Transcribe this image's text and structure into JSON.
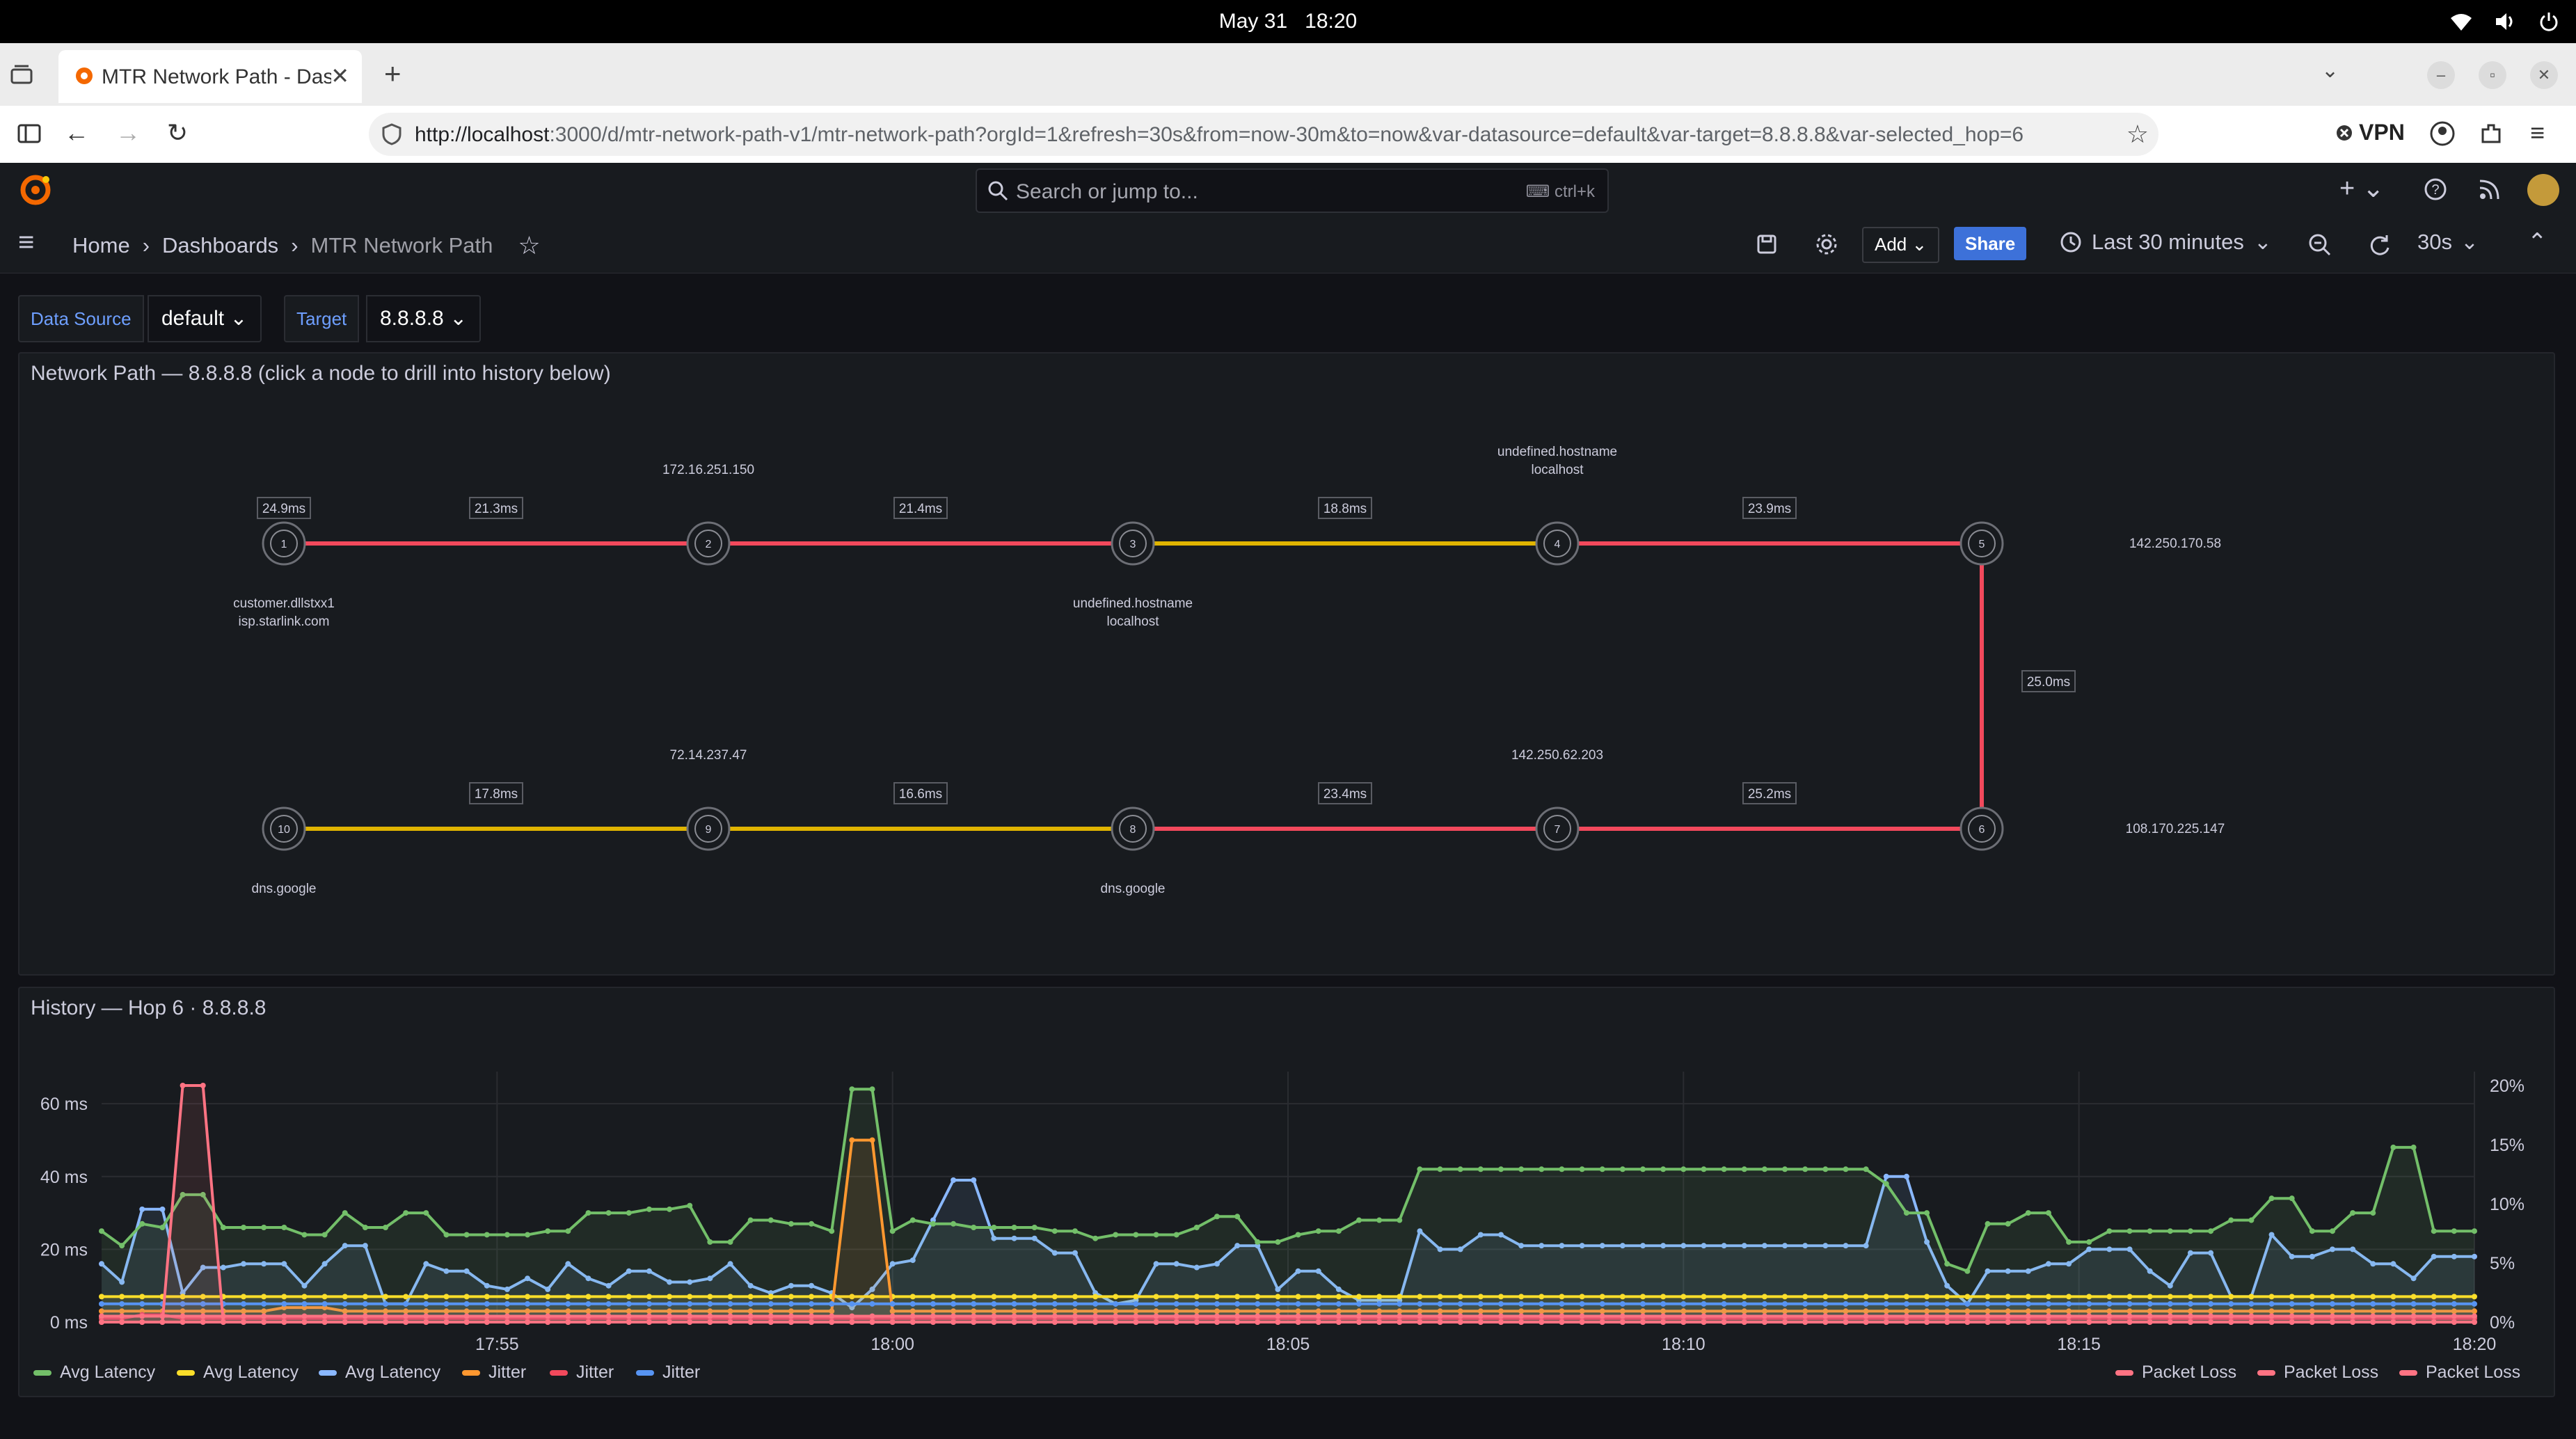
{
  "os": {
    "date": "May 31",
    "time": "18:20"
  },
  "browser": {
    "tab_title": "MTR Network Path - Dashboards",
    "url_host": "http://localhost",
    "url_rest": ":3000/d/mtr-network-path-v1/mtr-network-path?orgId=1&refresh=30s&from=now-30m&to=now&var-datasource=default&var-target=8.8.8.8&var-selected_hop=6",
    "vpn_label": "VPN"
  },
  "grafana": {
    "search_placeholder": "Search or jump to...",
    "search_shortcut": "ctrl+k",
    "breadcrumb": [
      "Home",
      "Dashboards",
      "MTR Network Path"
    ],
    "add_label": "Add",
    "share_label": "Share",
    "time_range": "Last 30 minutes",
    "refresh_interval": "30s"
  },
  "variables": {
    "datasource_label": "Data Source",
    "datasource_value": "default",
    "target_label": "Target",
    "target_value": "8.8.8.8"
  },
  "network_panel": {
    "title": "Network Path — 8.8.8.8 (click a node to drill into history below)",
    "nodes": [
      {
        "id": "1",
        "labels": [
          "customer.dllstxx1",
          "isp.starlink.com"
        ]
      },
      {
        "id": "2",
        "labels": [
          "172.16.251.150"
        ]
      },
      {
        "id": "3",
        "labels": [
          "undefined.hostname",
          "localhost"
        ]
      },
      {
        "id": "4",
        "labels": [
          "undefined.hostname",
          "localhost"
        ]
      },
      {
        "id": "5",
        "labels": [
          "142.250.170.58"
        ]
      },
      {
        "id": "6",
        "labels": [
          "108.170.225.147"
        ]
      },
      {
        "id": "7",
        "labels": [
          "142.250.62.203"
        ]
      },
      {
        "id": "8",
        "labels": [
          "dns.google"
        ]
      },
      {
        "id": "9",
        "labels": [
          "72.14.237.47"
        ]
      },
      {
        "id": "10",
        "labels": [
          "dns.google"
        ]
      }
    ],
    "node1_latency": "24.9ms",
    "edges": [
      {
        "from": "1",
        "to": "2",
        "latency": "21.3ms",
        "status": "red"
      },
      {
        "from": "2",
        "to": "3",
        "latency": "21.4ms",
        "status": "red"
      },
      {
        "from": "3",
        "to": "4",
        "latency": "18.8ms",
        "status": "yellow"
      },
      {
        "from": "4",
        "to": "5",
        "latency": "23.9ms",
        "status": "red"
      },
      {
        "from": "5",
        "to": "6",
        "latency": "25.0ms",
        "status": "red"
      },
      {
        "from": "6",
        "to": "7",
        "latency": "25.2ms",
        "status": "red"
      },
      {
        "from": "7",
        "to": "8",
        "latency": "23.4ms",
        "status": "red"
      },
      {
        "from": "8",
        "to": "9",
        "latency": "16.6ms",
        "status": "yellow"
      },
      {
        "from": "9",
        "to": "10",
        "latency": "17.8ms",
        "status": "yellow"
      }
    ],
    "colors": {
      "red": "#f2495c",
      "yellow": "#e0b400"
    }
  },
  "history_panel": {
    "title": "History — Hop 6 · 8.8.8.8",
    "legend_left": [
      {
        "label": "Avg Latency",
        "color": "#73bf69"
      },
      {
        "label": "Avg Latency",
        "color": "#fade2a"
      },
      {
        "label": "Avg Latency",
        "color": "#8ab8ff"
      },
      {
        "label": "Jitter",
        "color": "#ff9830"
      },
      {
        "label": "Jitter",
        "color": "#f2495c"
      },
      {
        "label": "Jitter",
        "color": "#5794f2"
      }
    ],
    "legend_right": [
      {
        "label": "Packet Loss",
        "color": "#ff7383"
      },
      {
        "label": "Packet Loss",
        "color": "#ff7383"
      },
      {
        "label": "Packet Loss",
        "color": "#ff7383"
      }
    ]
  },
  "chart_data": {
    "type": "line",
    "title": "History — Hop 6 · 8.8.8.8",
    "x_ticks": [
      "17:55",
      "18:00",
      "18:05",
      "18:10",
      "18:15",
      "18:20"
    ],
    "y_left_ticks": [
      "0 ms",
      "20 ms",
      "40 ms",
      "60 ms"
    ],
    "y_right_ticks": [
      "0%",
      "5%",
      "10%",
      "15%",
      "20%"
    ],
    "ylim_left": [
      0,
      65
    ],
    "ylim_right": [
      0,
      20
    ],
    "x_range_minutes": [
      0,
      30
    ],
    "series": [
      {
        "name": "Avg Latency",
        "color": "#73bf69",
        "axis": "left",
        "values": [
          25,
          21,
          27,
          26,
          35,
          35,
          26,
          26,
          26,
          26,
          24,
          24,
          30,
          26,
          26,
          30,
          30,
          24,
          24,
          24,
          24,
          24,
          25,
          25,
          30,
          30,
          30,
          31,
          31,
          32,
          22,
          22,
          28,
          28,
          27,
          27,
          25,
          64,
          64,
          25,
          28,
          27,
          27,
          26,
          26,
          26,
          26,
          25,
          25,
          23,
          24,
          24,
          24,
          24,
          26,
          29,
          29,
          22,
          22,
          24,
          25,
          25,
          28,
          28,
          28,
          42,
          42,
          42,
          42,
          42,
          42,
          42,
          42,
          42,
          42,
          42,
          42,
          42,
          42,
          42,
          42,
          42,
          42,
          42,
          42,
          42,
          42,
          42,
          38,
          30,
          30,
          16,
          14,
          27,
          27,
          30,
          30,
          22,
          22,
          25,
          25,
          25,
          25,
          25,
          25,
          28,
          28,
          34,
          34,
          25,
          25,
          30,
          30,
          48,
          48,
          25,
          25,
          25
        ]
      },
      {
        "name": "Avg Latency",
        "color": "#fade2a",
        "axis": "left",
        "values": [
          7,
          7,
          7,
          7,
          7,
          7,
          7,
          7,
          7,
          7,
          7,
          7,
          7,
          7,
          7,
          7,
          7,
          7,
          7,
          7,
          7,
          7,
          7,
          7,
          7,
          7,
          7,
          7,
          7,
          7,
          7,
          7,
          7,
          7,
          7,
          7,
          7,
          7,
          7,
          7,
          7,
          7,
          7,
          7,
          7,
          7,
          7,
          7,
          7,
          7,
          7,
          7,
          7,
          7,
          7,
          7,
          7,
          7,
          7,
          7,
          7,
          7,
          7,
          7,
          7,
          7,
          7,
          7,
          7,
          7,
          7,
          7,
          7,
          7,
          7,
          7,
          7,
          7,
          7,
          7,
          7,
          7,
          7,
          7,
          7,
          7,
          7,
          7,
          7,
          7,
          7,
          7,
          7,
          7,
          7,
          7,
          7,
          7,
          7,
          7,
          7,
          7,
          7,
          7,
          7,
          7,
          7,
          7,
          7,
          7,
          7,
          7,
          7,
          7,
          7,
          7,
          7,
          7
        ]
      },
      {
        "name": "Avg Latency",
        "color": "#8ab8ff",
        "axis": "left",
        "values": [
          16,
          11,
          31,
          31,
          8,
          15,
          15,
          16,
          16,
          16,
          10,
          16,
          21,
          21,
          5,
          5,
          16,
          14,
          14,
          10,
          9,
          12,
          9,
          16,
          12,
          10,
          14,
          14,
          11,
          11,
          12,
          16,
          10,
          8,
          10,
          10,
          8,
          4,
          9,
          16,
          17,
          28,
          39,
          39,
          23,
          23,
          23,
          19,
          19,
          8,
          5,
          6,
          16,
          16,
          15,
          16,
          21,
          21,
          9,
          14,
          14,
          9,
          6,
          6,
          6,
          25,
          20,
          20,
          24,
          24,
          21,
          21,
          21,
          21,
          21,
          21,
          21,
          21,
          21,
          21,
          21,
          21,
          21,
          21,
          21,
          21,
          21,
          21,
          40,
          40,
          22,
          10,
          5,
          14,
          14,
          14,
          16,
          16,
          20,
          20,
          20,
          14,
          10,
          19,
          19,
          7,
          7,
          24,
          18,
          18,
          20,
          20,
          16,
          16,
          12,
          18,
          18,
          18
        ]
      },
      {
        "name": "Jitter",
        "color": "#ff9830",
        "axis": "left",
        "values": [
          3,
          3,
          3,
          3,
          3,
          3,
          3,
          3,
          3,
          4,
          4,
          4,
          3,
          3,
          3,
          3,
          3,
          3,
          3,
          3,
          3,
          3,
          3,
          3,
          3,
          3,
          3,
          3,
          3,
          3,
          3,
          3,
          3,
          3,
          3,
          3,
          3,
          50,
          50,
          3,
          3,
          3,
          3,
          3,
          3,
          3,
          3,
          3,
          3,
          3,
          3,
          3,
          3,
          3,
          3,
          3,
          3,
          3,
          3,
          3,
          3,
          3,
          3,
          3,
          3,
          3,
          3,
          3,
          3,
          3,
          3,
          3,
          3,
          3,
          3,
          3,
          3,
          3,
          3,
          3,
          3,
          3,
          3,
          3,
          3,
          3,
          3,
          3,
          3,
          3,
          3,
          3,
          3,
          3,
          3,
          3,
          3,
          3,
          3,
          3,
          3,
          3,
          3,
          3,
          3,
          3,
          3,
          3,
          3,
          3,
          3,
          3,
          3,
          3,
          3,
          3,
          3,
          3
        ]
      },
      {
        "name": "Jitter",
        "color": "#f2495c",
        "axis": "left",
        "values": [
          1,
          1,
          2,
          2,
          1,
          1,
          1,
          1,
          1,
          1,
          1,
          1,
          1,
          1,
          1,
          1,
          1,
          1,
          1,
          1,
          1,
          1,
          1,
          1,
          1,
          1,
          1,
          1,
          1,
          1,
          1,
          1,
          1,
          1,
          1,
          1,
          1,
          1,
          1,
          1,
          1,
          1,
          1,
          1,
          1,
          1,
          1,
          1,
          1,
          1,
          1,
          1,
          1,
          1,
          1,
          1,
          1,
          1,
          1,
          1,
          1,
          1,
          1,
          1,
          1,
          1,
          1,
          1,
          1,
          1,
          1,
          1,
          1,
          1,
          1,
          1,
          1,
          1,
          1,
          1,
          1,
          1,
          1,
          1,
          1,
          1,
          1,
          1,
          1,
          1,
          1,
          1,
          1,
          1,
          1,
          1,
          1,
          1,
          1,
          1,
          1,
          1,
          1,
          1,
          1,
          1,
          1,
          1,
          1,
          1,
          1,
          1,
          1,
          1,
          1,
          1,
          1,
          1
        ]
      },
      {
        "name": "Jitter",
        "color": "#5794f2",
        "axis": "left",
        "values": [
          5,
          5,
          5,
          5,
          5,
          5,
          5,
          5,
          5,
          5,
          5,
          5,
          5,
          5,
          5,
          5,
          5,
          5,
          5,
          5,
          5,
          5,
          5,
          5,
          5,
          5,
          5,
          5,
          5,
          5,
          5,
          5,
          5,
          5,
          5,
          5,
          5,
          5,
          5,
          5,
          5,
          5,
          5,
          5,
          5,
          5,
          5,
          5,
          5,
          5,
          5,
          5,
          5,
          5,
          5,
          5,
          5,
          5,
          5,
          5,
          5,
          5,
          5,
          5,
          5,
          5,
          5,
          5,
          5,
          5,
          5,
          5,
          5,
          5,
          5,
          5,
          5,
          5,
          5,
          5,
          5,
          5,
          5,
          5,
          5,
          5,
          5,
          5,
          5,
          5,
          5,
          5,
          5,
          5,
          5,
          5,
          5,
          5,
          5,
          5,
          5,
          5,
          5,
          5,
          5,
          5,
          5,
          5,
          5,
          5,
          5,
          5,
          5,
          5,
          5,
          5,
          5,
          5
        ]
      },
      {
        "name": "Packet Loss",
        "color": "#ff7383",
        "axis": "right",
        "values": [
          0,
          0,
          0,
          0,
          0,
          0,
          0,
          0,
          0,
          0,
          0,
          0,
          0,
          0,
          0,
          0,
          0,
          0,
          0,
          0,
          0,
          0,
          0,
          0,
          0,
          0,
          0,
          0,
          0,
          0,
          0,
          0,
          0,
          0,
          0,
          0,
          0,
          0,
          0,
          0,
          0,
          0,
          0,
          0,
          0,
          0,
          0,
          0,
          0,
          0,
          0,
          0,
          0,
          0,
          0,
          0,
          0,
          0,
          0,
          0,
          0,
          0,
          0,
          0,
          0,
          0,
          0,
          0,
          0,
          0,
          0,
          0,
          0,
          0,
          0,
          0,
          0,
          0,
          0,
          0,
          0,
          0,
          0,
          0,
          0,
          0,
          0,
          0,
          0,
          0,
          0,
          0,
          0,
          0,
          0,
          0,
          0,
          0,
          0,
          0,
          0,
          0,
          0,
          0,
          0,
          0,
          0,
          0,
          0,
          0,
          0,
          0,
          0,
          0,
          0,
          0,
          0,
          0
        ]
      },
      {
        "name": "Packet Loss",
        "color": "#ff7383",
        "axis": "right",
        "values": [
          0,
          0,
          0,
          0,
          20,
          20,
          0,
          0,
          0,
          0,
          0,
          0,
          0,
          0,
          0,
          0,
          0,
          0,
          0,
          0,
          0,
          0,
          0,
          0,
          0,
          0,
          0,
          0,
          0,
          0,
          0,
          0,
          0,
          0,
          0,
          0,
          0,
          0,
          0,
          0,
          0,
          0,
          0,
          0,
          0,
          0,
          0,
          0,
          0,
          0,
          0,
          0,
          0,
          0,
          0,
          0,
          0,
          0,
          0,
          0,
          0,
          0,
          0,
          0,
          0,
          0,
          0,
          0,
          0,
          0,
          0,
          0,
          0,
          0,
          0,
          0,
          0,
          0,
          0,
          0,
          0,
          0,
          0,
          0,
          0,
          0,
          0,
          0,
          0,
          0,
          0,
          0,
          0,
          0,
          0,
          0,
          0,
          0,
          0,
          0,
          0,
          0,
          0,
          0,
          0,
          0,
          0,
          0,
          0,
          0,
          0,
          0,
          0,
          0,
          0,
          0,
          0,
          0
        ]
      },
      {
        "name": "Packet Loss",
        "color": "#ff7383",
        "axis": "right",
        "values": [
          0.5,
          0.5,
          0.5,
          0.5,
          0.5,
          0.5,
          0.5,
          0.5,
          0.5,
          0.5,
          0.5,
          0.5,
          0.5,
          0.5,
          0.5,
          0.5,
          0.5,
          0.5,
          0.5,
          0.5,
          0.5,
          0.5,
          0.5,
          0.5,
          0.5,
          0.5,
          0.5,
          0.5,
          0.5,
          0.5,
          0.5,
          0.5,
          0.5,
          0.5,
          0.5,
          0.5,
          0.5,
          0.5,
          0.5,
          0.5,
          0.5,
          0.5,
          0.5,
          0.5,
          0.5,
          0.5,
          0.5,
          0.5,
          0.5,
          0.5,
          0.5,
          0.5,
          0.5,
          0.5,
          0.5,
          0.5,
          0.5,
          0.5,
          0.5,
          0.5,
          0.5,
          0.5,
          0.5,
          0.5,
          0.5,
          0.5,
          0.5,
          0.5,
          0.5,
          0.5,
          0.5,
          0.5,
          0.5,
          0.5,
          0.5,
          0.5,
          0.5,
          0.5,
          0.5,
          0.5,
          0.5,
          0.5,
          0.5,
          0.5,
          0.5,
          0.5,
          0.5,
          0.5,
          0.5,
          0.5,
          0.5,
          0.5,
          0.5,
          0.5,
          0.5,
          0.5,
          0.5,
          0.5,
          0.5,
          0.5,
          0.5,
          0.5,
          0.5,
          0.5,
          0.5,
          0.5,
          0.5,
          0.5,
          0.5,
          0.5,
          0.5,
          0.5,
          0.5,
          0.5,
          0.5,
          0.5,
          0.5,
          0.5
        ]
      }
    ]
  }
}
